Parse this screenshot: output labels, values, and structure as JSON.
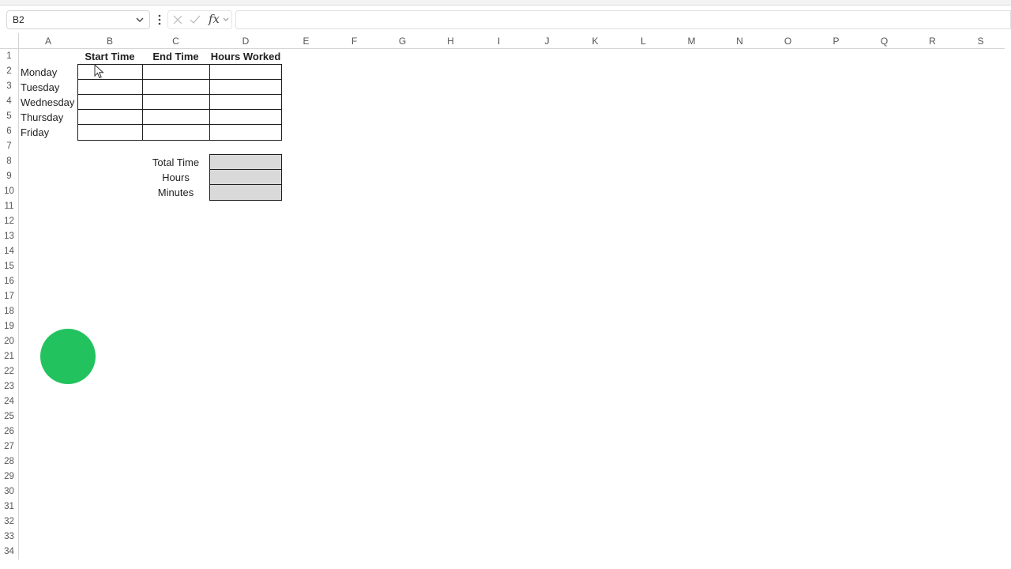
{
  "formula_bar": {
    "name_box": "B2",
    "fx_label": "fx",
    "formula": ""
  },
  "columns": [
    "A",
    "B",
    "C",
    "D",
    "E",
    "F",
    "G",
    "H",
    "I",
    "J",
    "K",
    "L",
    "M",
    "N",
    "O",
    "P",
    "Q",
    "R",
    "S"
  ],
  "rows": [
    "1",
    "2",
    "3",
    "4",
    "5",
    "6",
    "7",
    "8",
    "9",
    "10",
    "11",
    "12",
    "13",
    "14",
    "15",
    "16",
    "17",
    "18",
    "19",
    "20",
    "21",
    "22",
    "23",
    "24",
    "25",
    "26",
    "27",
    "28",
    "29",
    "30",
    "31",
    "32",
    "33",
    "34"
  ],
  "sheet": {
    "headers": {
      "start": "Start Time",
      "end": "End Time",
      "hours": "Hours Worked"
    },
    "days": [
      "Monday",
      "Tuesday",
      "Wednesday",
      "Thursday",
      "Friday"
    ],
    "summary_labels": [
      "Total Time",
      "Hours",
      "Minutes"
    ]
  },
  "colors": {
    "summary_fill": "#d9d9d9",
    "recording_dot": "#22c35e"
  }
}
